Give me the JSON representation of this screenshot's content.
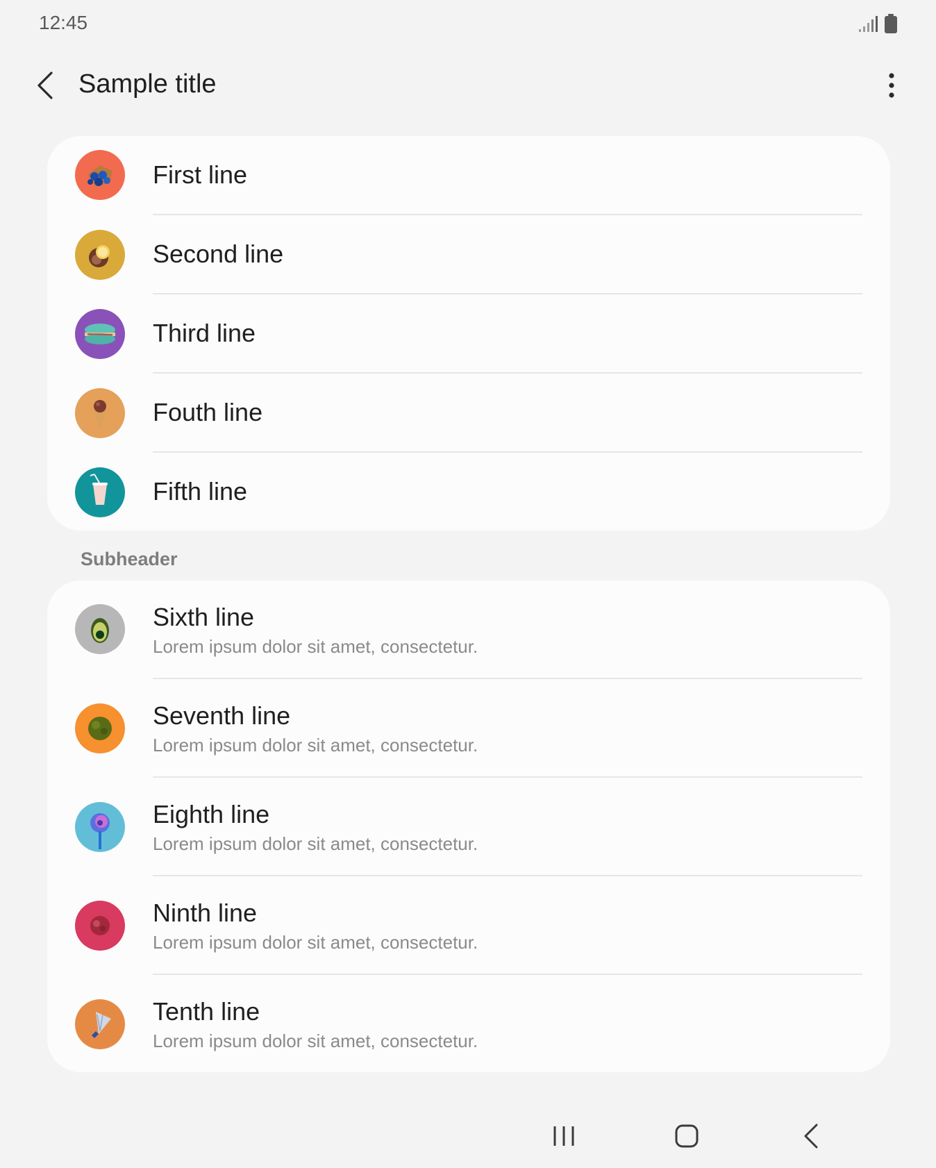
{
  "status_bar": {
    "time": "12:45"
  },
  "header": {
    "title": "Sample title"
  },
  "list_primary": [
    {
      "label": "First line",
      "icon": "toy-basket-icon",
      "color": "#f26b4f"
    },
    {
      "label": "Second line",
      "icon": "coconut-icon",
      "color": "#d9a93a"
    },
    {
      "label": "Third line",
      "icon": "macaron-icon",
      "color": "#8a52b8"
    },
    {
      "label": "Fouth line",
      "icon": "ice-cream-cone-icon",
      "color": "#e5a05a"
    },
    {
      "label": "Fifth line",
      "icon": "drink-cup-icon",
      "color": "#11959a"
    }
  ],
  "subheader": "Subheader",
  "list_secondary": [
    {
      "label": "Sixth line",
      "sub": "Lorem ipsum dolor sit amet, consectetur.",
      "icon": "avocado-icon",
      "color": "#b7b7b7"
    },
    {
      "label": "Seventh line",
      "sub": "Lorem ipsum dolor sit amet, consectetur.",
      "icon": "moss-ball-icon",
      "color": "#f7902f"
    },
    {
      "label": "Eighth line",
      "sub": "Lorem ipsum dolor sit amet, consectetur.",
      "icon": "lollipop-icon",
      "color": "#62bed7"
    },
    {
      "label": "Ninth line",
      "sub": "Lorem ipsum dolor sit amet, consectetur.",
      "icon": "sweet-ball-icon",
      "color": "#d93a5f"
    },
    {
      "label": "Tenth line",
      "sub": "Lorem ipsum dolor sit amet, consectetur.",
      "icon": "shuttlecock-icon",
      "color": "#e58a45"
    }
  ]
}
